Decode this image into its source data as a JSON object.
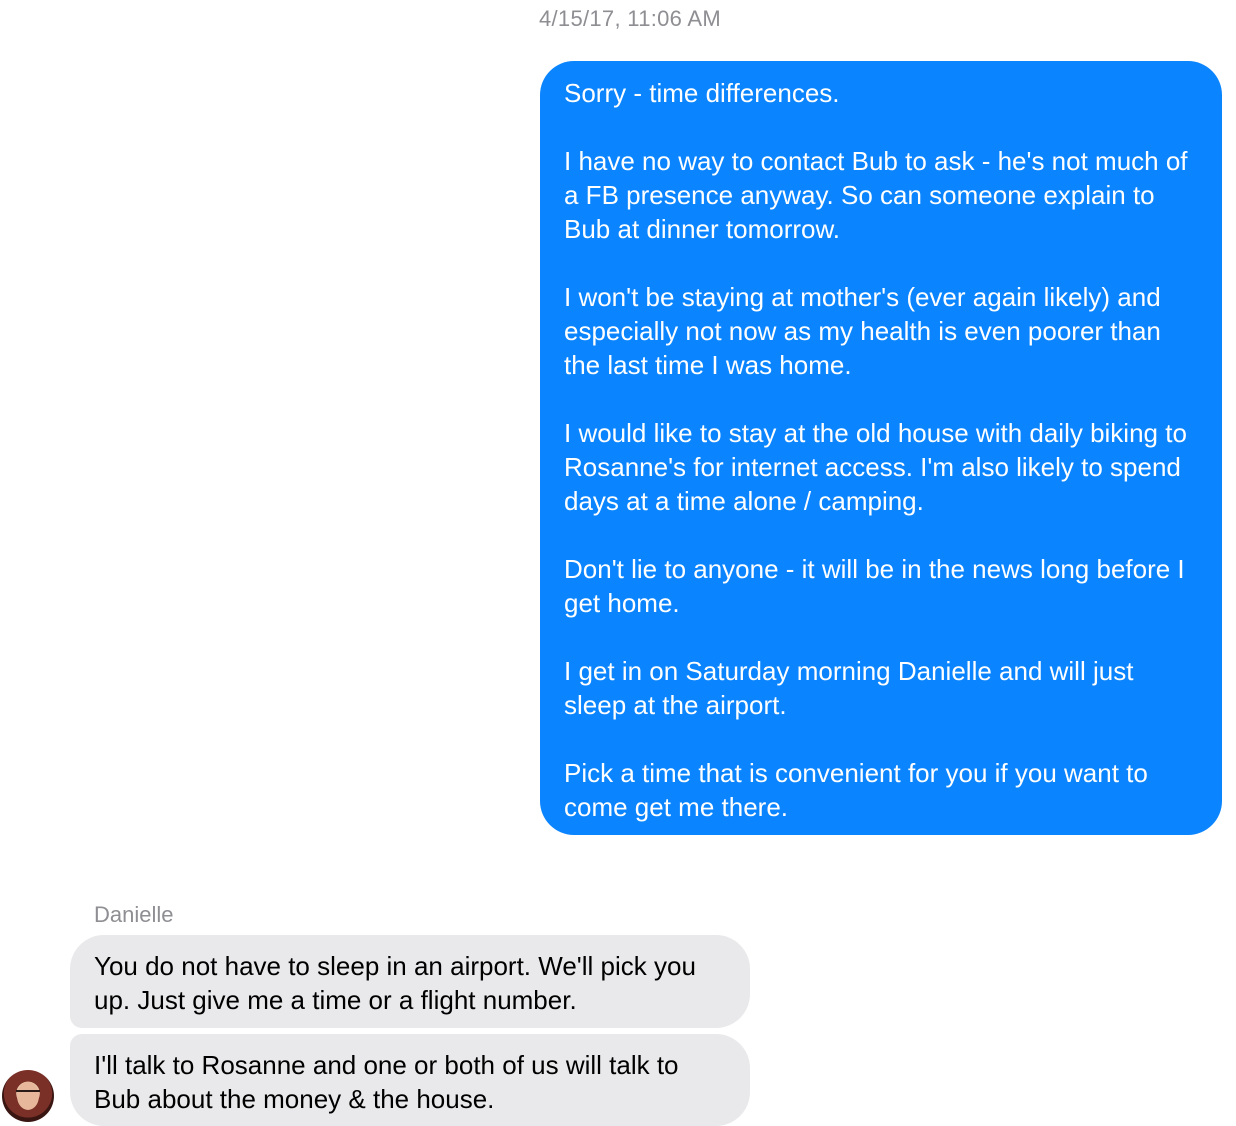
{
  "timestamp": "4/15/17, 11:06 AM",
  "outgoing_message": {
    "paragraphs": [
      "Sorry - time differences.",
      "I have no way to contact Bub to ask - he's not much of a FB presence anyway.  So can someone explain to Bub at dinner tomorrow.",
      "I won't be staying at mother's (ever again likely) and especially not now as my health is even poorer than the last time I was home.",
      "I would like to stay at the old house with daily biking to Rosanne's for internet access.  I'm also likely to spend days at a time alone / camping.",
      "Don't lie to anyone - it will be in the news long before I get home.",
      "I get in on Saturday morning Danielle and will just sleep at the airport.",
      "Pick a time that is convenient for you if you want to come get me there."
    ],
    "color": "#0a84ff"
  },
  "incoming": {
    "sender": "Danielle",
    "messages": [
      "You do not have to sleep in an airport. We'll pick you up. Just give me a time or a flight number.",
      "I'll talk to Rosanne and one or both of us will talk to Bub about the money & the house."
    ],
    "color": "#e9e9eb",
    "avatar_icon": "avatar"
  }
}
